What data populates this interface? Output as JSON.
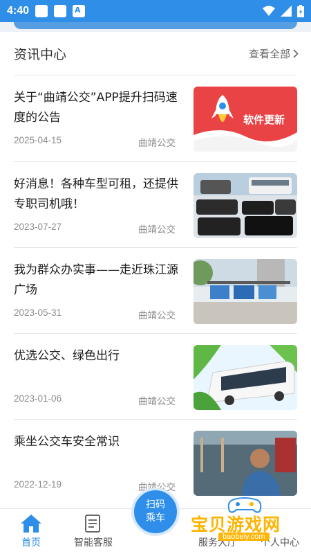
{
  "status_bar": {
    "time": "4:40"
  },
  "news_section": {
    "title": "资讯中心",
    "view_all": "查看全部"
  },
  "news": [
    {
      "title": "关于“曲靖公交”APP提升扫码速度的公告",
      "date": "2025-04-15",
      "source": "曲靖公交",
      "thumb_text": "软件更新"
    },
    {
      "title": "好消息！各种车型可租，还提供专职司机哦！",
      "date": "2023-07-27",
      "source": "曲靖公交"
    },
    {
      "title": "我为群众办实事——走近珠江源广场",
      "date": "2023-05-31",
      "source": "曲靖公交"
    },
    {
      "title": "优选公交、绿色出行",
      "date": "2023-01-06",
      "source": "曲靖公交"
    },
    {
      "title": "乘坐公交车安全常识",
      "date": "2022-12-19",
      "source": "曲靖公交"
    }
  ],
  "tabs": {
    "home": "首页",
    "service": "智能客服",
    "scan_line1": "扫码",
    "scan_line2": "乘车",
    "hall": "服务大厅",
    "profile": "个人中心"
  },
  "watermark": {
    "text": "宝贝游戏网",
    "url": "baobeiy.com"
  },
  "colors": {
    "primary": "#2f8ee8",
    "watermark": "#ffb400"
  }
}
